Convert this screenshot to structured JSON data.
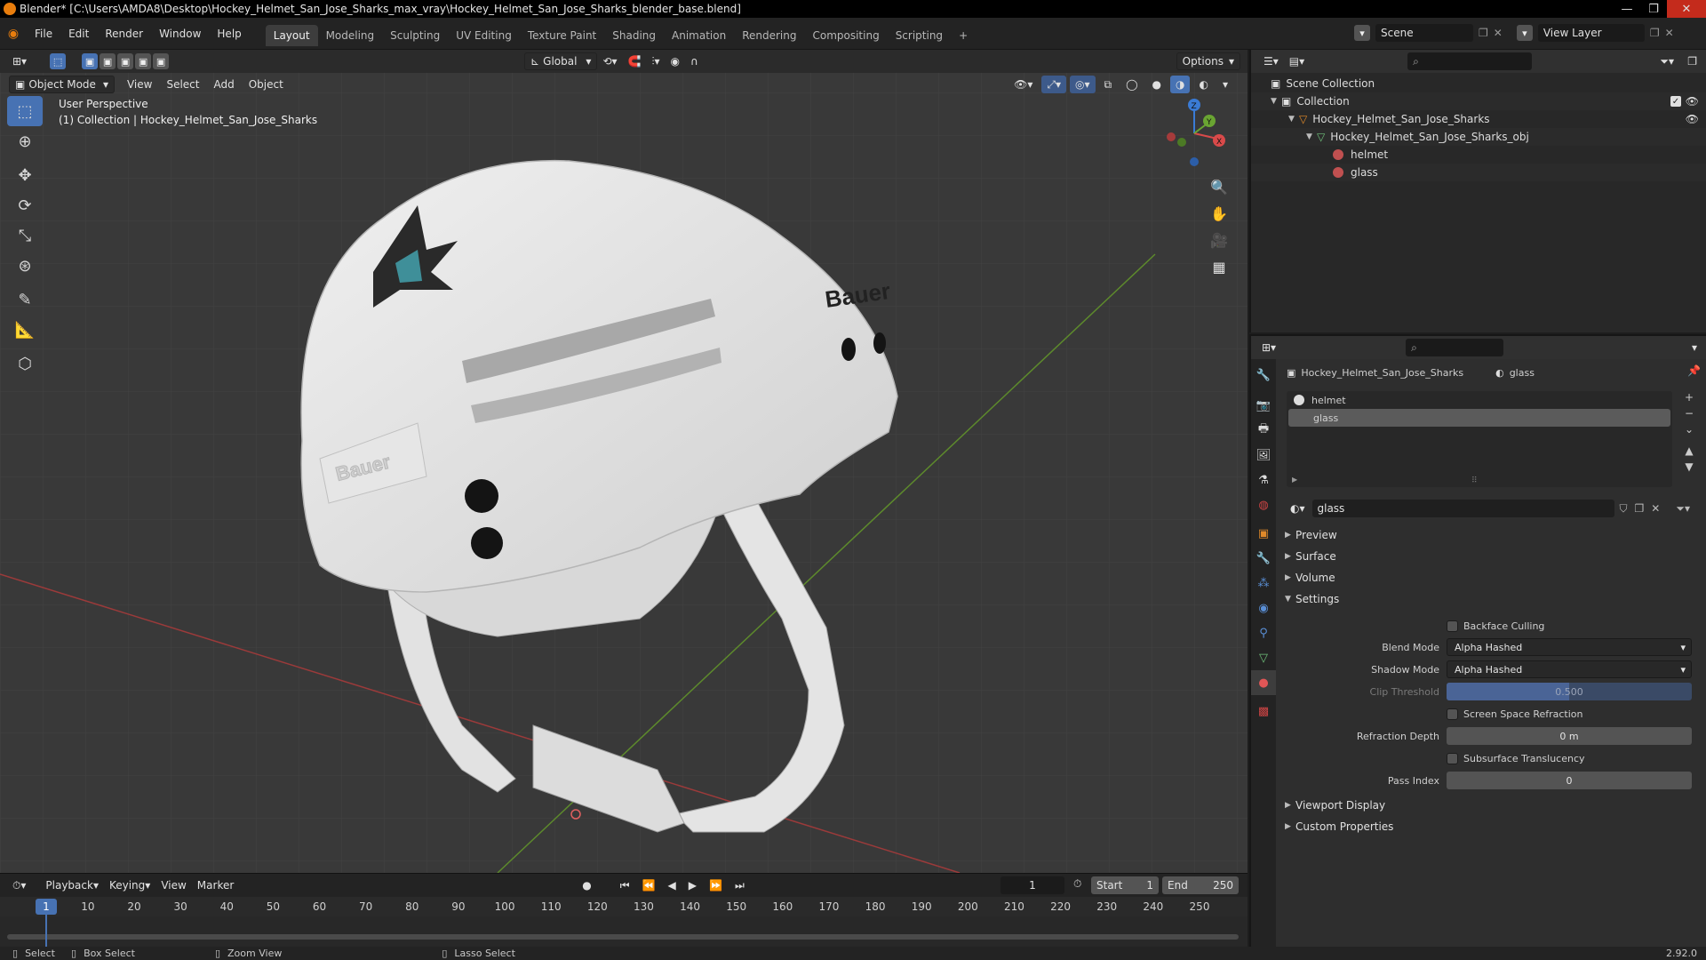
{
  "window": {
    "title": "Blender* [C:\\Users\\AMDA8\\Desktop\\Hockey_Helmet_San_Jose_Sharks_max_vray\\Hockey_Helmet_San_Jose_Sharks_blender_base.blend]",
    "min": "—",
    "max": "❐",
    "close": "✕"
  },
  "menu": [
    "File",
    "Edit",
    "Render",
    "Window",
    "Help"
  ],
  "workspaces": [
    "Layout",
    "Modeling",
    "Sculpting",
    "UV Editing",
    "Texture Paint",
    "Shading",
    "Animation",
    "Rendering",
    "Compositing",
    "Scripting"
  ],
  "add_workspace": "+",
  "scene": {
    "name": "Scene",
    "view_layer": "View Layer"
  },
  "viewport": {
    "mode": "Object Mode",
    "menu": [
      "View",
      "Select",
      "Add",
      "Object"
    ],
    "transform_orientation": "Global",
    "options": "Options",
    "overlay_line1": "User Perspective",
    "overlay_line2": "(1) Collection | Hockey_Helmet_San_Jose_Sharks",
    "gizmo": {
      "x": "X",
      "y": "Y",
      "z": "Z"
    }
  },
  "helmet": {
    "brand_side": "Bauer",
    "brand_back": "Bauer"
  },
  "timeline": {
    "menu": [
      "Playback",
      "Keying",
      "View",
      "Marker"
    ],
    "current_frame": "1",
    "start_label": "Start",
    "start": "1",
    "end_label": "End",
    "end": "250",
    "ticks": [
      "1",
      "10",
      "20",
      "30",
      "40",
      "50",
      "60",
      "70",
      "80",
      "90",
      "100",
      "110",
      "120",
      "130",
      "140",
      "150",
      "160",
      "170",
      "180",
      "190",
      "200",
      "210",
      "220",
      "230",
      "240",
      "250"
    ]
  },
  "status": {
    "select": "Select",
    "box_select": "Box Select",
    "zoom_view": "Zoom View",
    "lasso_select": "Lasso Select",
    "version": "2.92.0"
  },
  "outliner": {
    "scene_collection": "Scene Collection",
    "collection": "Collection",
    "object": "Hockey_Helmet_San_Jose_Sharks",
    "mesh": "Hockey_Helmet_San_Jose_Sharks_obj",
    "mat1": "helmet",
    "mat2": "glass"
  },
  "properties": {
    "breadcrumb_object": "Hockey_Helmet_San_Jose_Sharks",
    "breadcrumb_material": "glass",
    "slots": [
      "helmet",
      "glass"
    ],
    "material_name": "glass",
    "panels": {
      "preview": "Preview",
      "surface": "Surface",
      "volume": "Volume",
      "settings": "Settings",
      "viewport_display": "Viewport Display",
      "custom_properties": "Custom Properties"
    },
    "settings": {
      "backface_culling": "Backface Culling",
      "blend_mode_label": "Blend Mode",
      "blend_mode": "Alpha Hashed",
      "shadow_mode_label": "Shadow Mode",
      "shadow_mode": "Alpha Hashed",
      "clip_threshold_label": "Clip Threshold",
      "clip_threshold": "0.500",
      "ssr": "Screen Space Refraction",
      "refraction_depth_label": "Refraction Depth",
      "refraction_depth": "0 m",
      "subsurface": "Subsurface Translucency",
      "pass_index_label": "Pass Index",
      "pass_index": "0"
    }
  }
}
